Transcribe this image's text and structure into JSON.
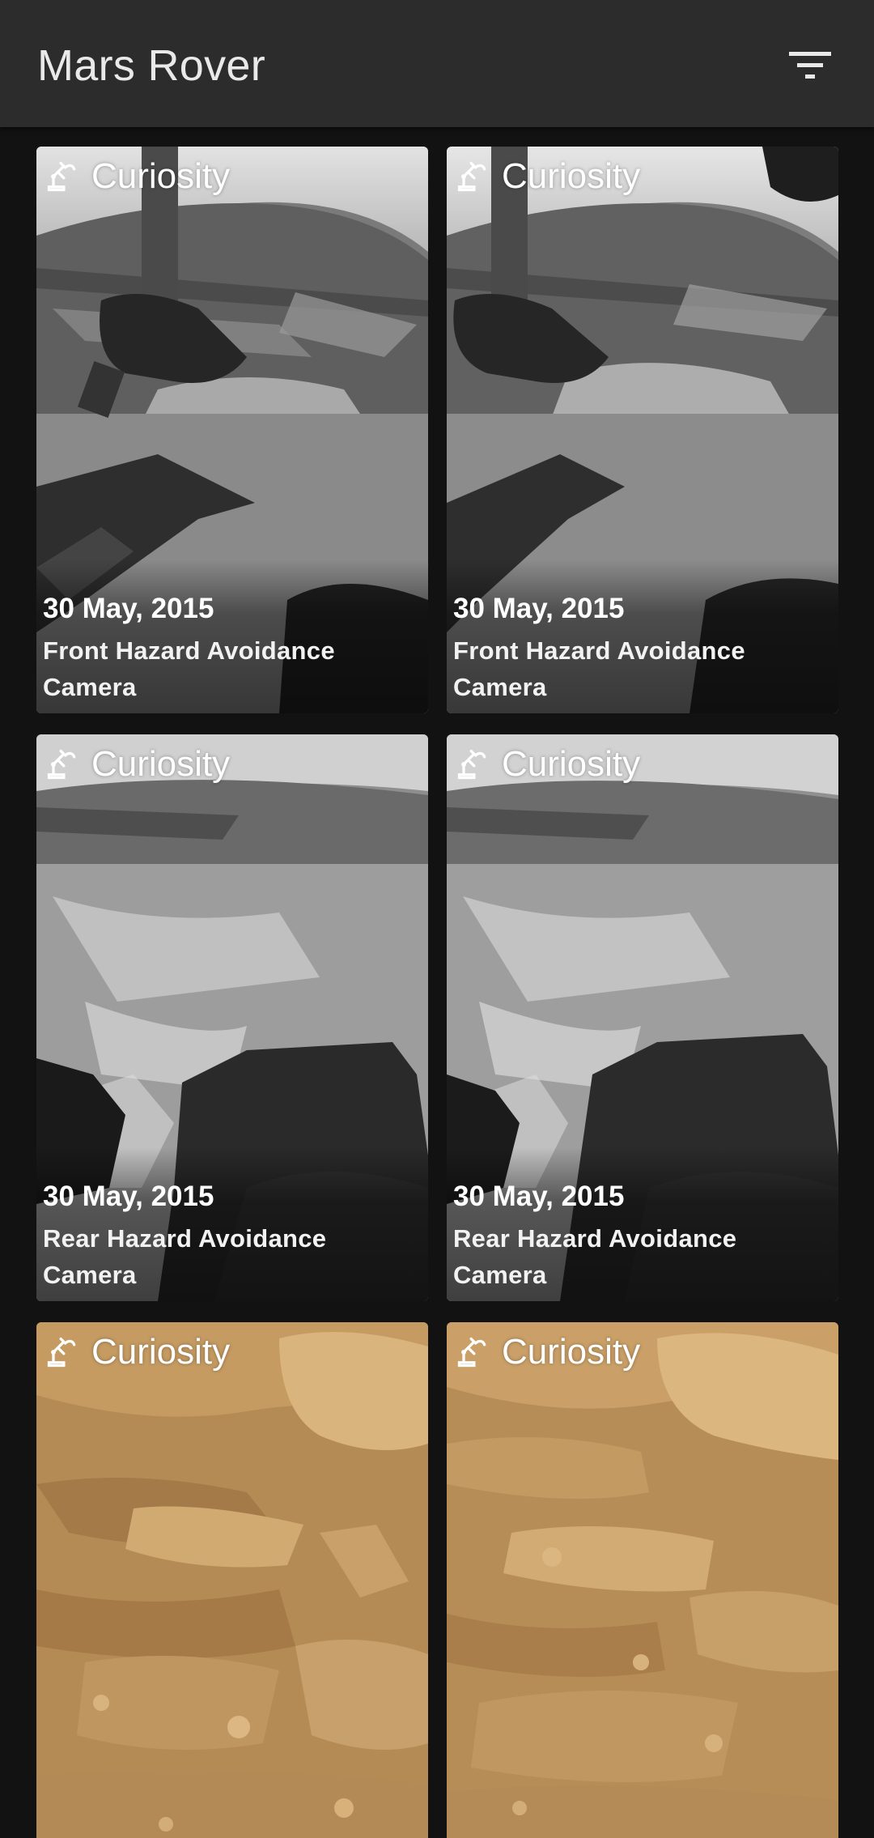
{
  "app": {
    "title": "Mars Rover",
    "filter_icon": "filter-list-icon"
  },
  "colors": {
    "toolbar": "#2c2c2c",
    "background": "#121212",
    "title_text": "#e9e9e9"
  },
  "photos": [
    {
      "rover": "Curiosity",
      "rover_icon": "rover-arm-icon",
      "date": "30 May, 2015",
      "camera": "Front Hazard Avoidance Camera",
      "tone": "grayscale"
    },
    {
      "rover": "Curiosity",
      "rover_icon": "rover-arm-icon",
      "date": "30 May, 2015",
      "camera": "Front Hazard Avoidance Camera",
      "tone": "grayscale"
    },
    {
      "rover": "Curiosity",
      "rover_icon": "rover-arm-icon",
      "date": "30 May, 2015",
      "camera": "Rear Hazard Avoidance Camera",
      "tone": "grayscale"
    },
    {
      "rover": "Curiosity",
      "rover_icon": "rover-arm-icon",
      "date": "30 May, 2015",
      "camera": "Rear Hazard Avoidance Camera",
      "tone": "grayscale"
    },
    {
      "rover": "Curiosity",
      "rover_icon": "rover-arm-icon",
      "tone": "color"
    },
    {
      "rover": "Curiosity",
      "rover_icon": "rover-arm-icon",
      "tone": "color"
    }
  ]
}
